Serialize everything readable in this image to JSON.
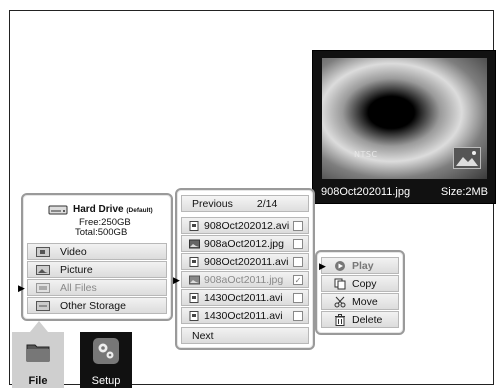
{
  "preview": {
    "overlay_text": "NTSC",
    "filename": "908Oct202011.jpg",
    "size": "Size:2MB"
  },
  "storage": {
    "drive_title": "Hard Drive",
    "drive_tag": "(Default)",
    "free": "Free:250GB",
    "total": "Total:500GB",
    "items": [
      {
        "label": "Video",
        "icon": "video-folder-icon"
      },
      {
        "label": "Picture",
        "icon": "picture-folder-icon"
      },
      {
        "label": "All Files",
        "icon": "all-files-folder-icon",
        "selected": true
      },
      {
        "label": "Other Storage",
        "icon": "other-storage-icon"
      }
    ]
  },
  "files": {
    "previous": "Previous",
    "page": "2/14",
    "items": [
      {
        "name": "908Oct202012.avi",
        "type": "video",
        "checked": false
      },
      {
        "name": "908aOct2012.jpg",
        "type": "picture",
        "checked": false
      },
      {
        "name": "908Oct202011.avi",
        "type": "video",
        "checked": false
      },
      {
        "name": "908aOct2011.jpg",
        "type": "picture",
        "checked": true,
        "selected": true
      },
      {
        "name": "1430Oct2011.avi",
        "type": "video",
        "checked": false
      },
      {
        "name": "1430Oct2011.avi",
        "type": "video",
        "checked": false
      }
    ],
    "next": "Next"
  },
  "actions": {
    "items": [
      {
        "label": "Play",
        "icon": "play-icon"
      },
      {
        "label": "Copy",
        "icon": "copy-icon"
      },
      {
        "label": "Move",
        "icon": "scissors-icon"
      },
      {
        "label": "Delete",
        "icon": "trash-icon"
      }
    ]
  },
  "tabs": {
    "file": "File",
    "setup": "Setup"
  },
  "colors": {
    "panel_border": "#9a9a9a",
    "selected_text": "#8a8a8a",
    "tab_active": "#cfcfcf",
    "tab_inactive": "#111111"
  }
}
